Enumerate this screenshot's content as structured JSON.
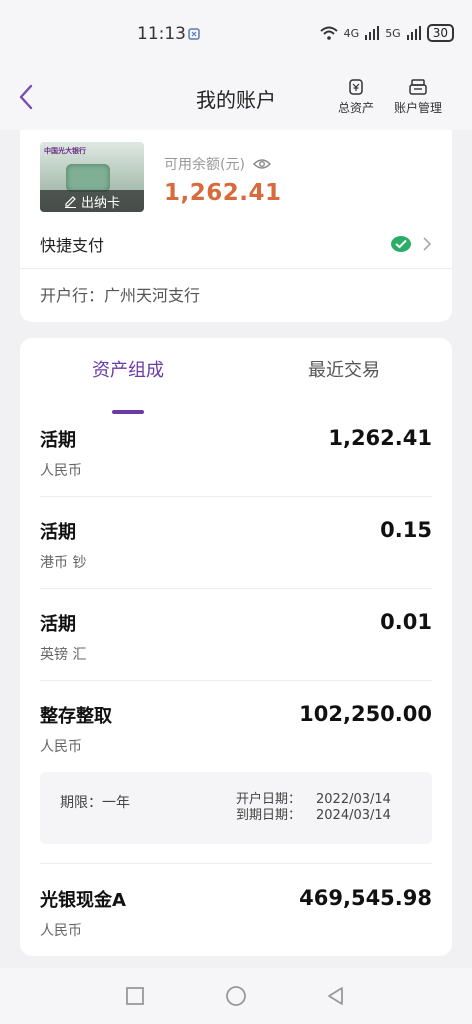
{
  "status_bar": {
    "time": "11:13",
    "signal_1": "6",
    "signal_2": "4G",
    "signal_3": "5G",
    "battery": "30"
  },
  "header": {
    "title": "我的账户",
    "actions": [
      {
        "label": "总资产",
        "icon": "wallet-icon"
      },
      {
        "label": "账户管理",
        "icon": "card-manage-icon"
      }
    ]
  },
  "account": {
    "card_bank_name": "中国光大银行",
    "withdraw_label": "出纳卡",
    "balance_label": "可用余额(元)",
    "balance": "1,262.41",
    "quick_pay_label": "快捷支付",
    "branch": "开户行：广州天河支行"
  },
  "tabs": [
    {
      "label": "资产组成",
      "active": true
    },
    {
      "label": "最近交易",
      "active": false
    }
  ],
  "assets": [
    {
      "name": "活期",
      "currency": "人民币",
      "amount": "1,262.41"
    },
    {
      "name": "活期",
      "currency": "港币 钞",
      "amount": "0.15"
    },
    {
      "name": "活期",
      "currency": "英镑 汇",
      "amount": "0.01"
    },
    {
      "name": "整存整取",
      "currency": "人民币",
      "amount": "102,250.00"
    },
    {
      "name": "光银现金A",
      "currency": "人民币",
      "amount": "469,545.98"
    }
  ],
  "term_deposit": {
    "term": "期限：一年",
    "open_date_label": "开户日期：",
    "open_date": "2022/03/14",
    "due_date_label": "到期日期：",
    "due_date": "2024/03/14"
  },
  "colors": {
    "accent": "#6a3aa8",
    "balance": "#d86a3c",
    "wechat_green": "#2aae67"
  }
}
